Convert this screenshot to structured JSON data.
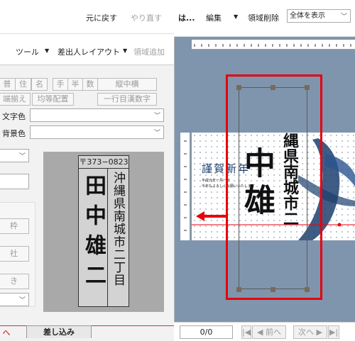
{
  "left_panel": {
    "undo_label": "元に戻す",
    "redo_label": "やり直す",
    "tools_menu_label": "ツール",
    "sender_layout_label": "差出人レイアウト",
    "add_area_label": "領域追加",
    "field_buttons": [
      "普",
      "住",
      "名",
      "手",
      "半",
      "数",
      "縦中横"
    ],
    "align_buttons": [
      "端揃え",
      "均等配置",
      "一行目漢数字"
    ],
    "text_color_label": "文字色",
    "bg_color_label": "背景色",
    "side_button_labels": [
      "枠",
      "社",
      "き"
    ],
    "preview": {
      "postal_code": "〒373−0823",
      "address": "沖縄県南城市二丁目",
      "name": "田中雄二"
    },
    "tab_merge_label": "差し込み"
  },
  "right_panel": {
    "title_fragment": "は...",
    "edit_menu_label": "編集",
    "delete_area_label": "領域削除",
    "view_select_value": "全体を表示",
    "card": {
      "greeting": "謹賀新年",
      "big_chars": "中雄",
      "address_top": "縄県南城市二",
      "small_lines": [
        "平成元年一月一日",
        "今年もよろしくお願いいたします"
      ]
    },
    "pager": {
      "page_indicator": "0/0",
      "prev_label": "◀ 前へ",
      "next_label": "次へ ▶"
    }
  },
  "colors": {
    "highlight_red": "#e8000b",
    "workspace_blue": "#7f95ad",
    "brush_blue": "#1d3f6e"
  }
}
